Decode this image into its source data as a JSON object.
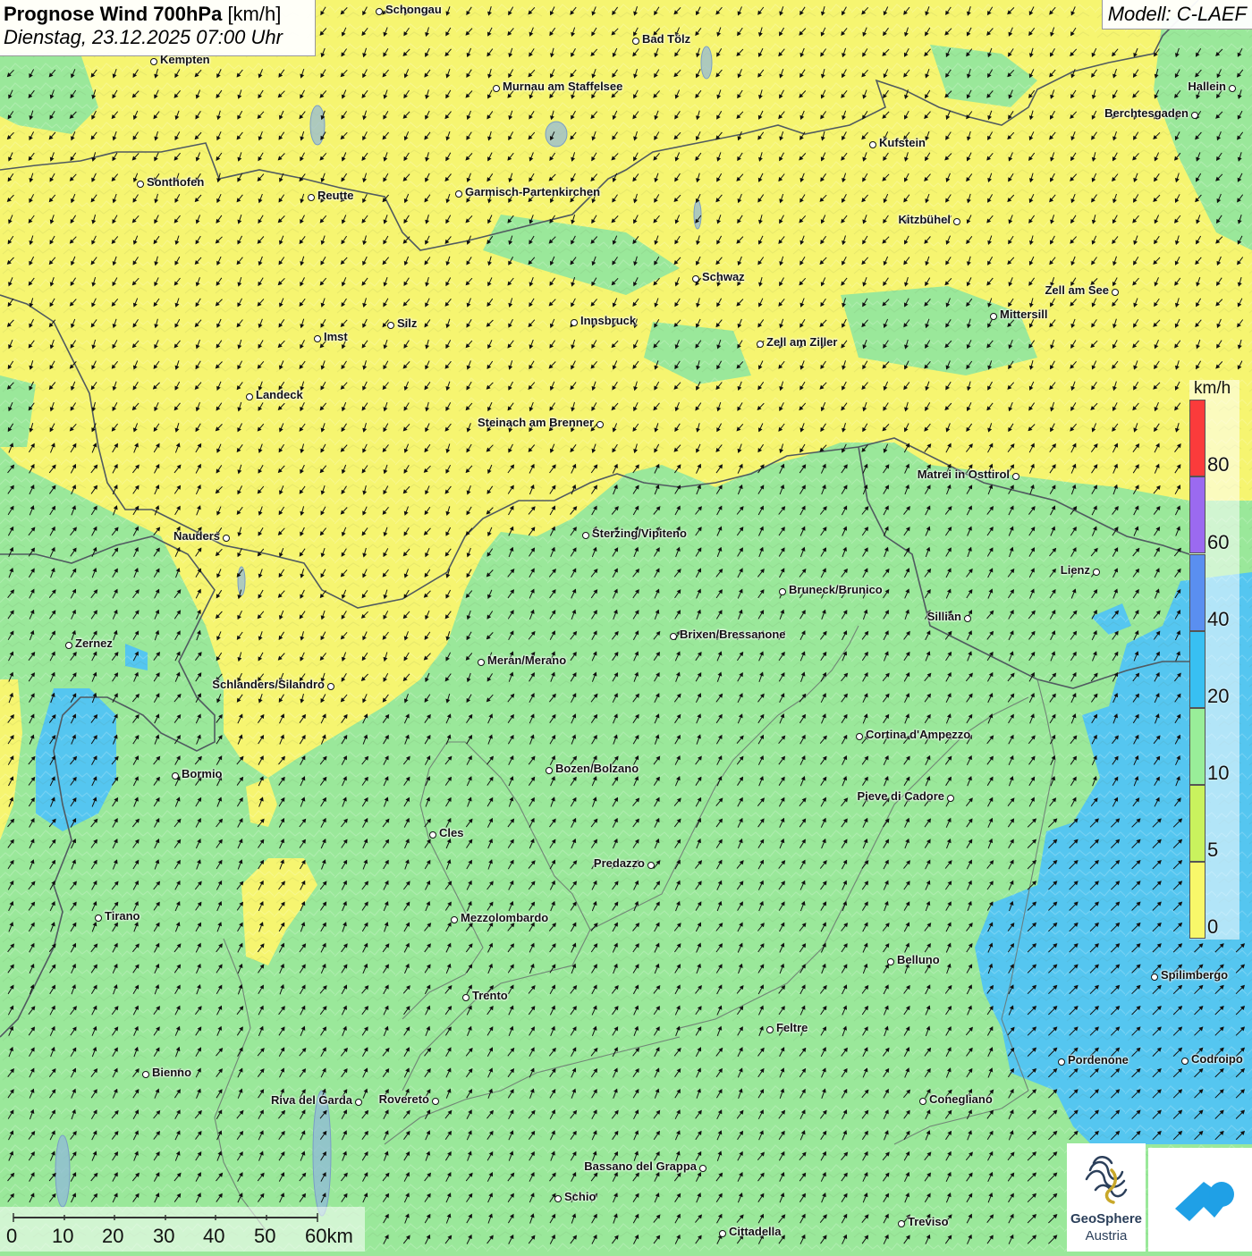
{
  "title": {
    "bold": "Prognose Wind 700hPa",
    "unit": "[km/h]",
    "datetime": "Dienstag, 23.12.2025 07:00 Uhr"
  },
  "model": "Modell: C-LAEF",
  "legend": {
    "unit": "km/h",
    "ticks": [
      "80",
      "60",
      "40",
      "20",
      "10",
      "5",
      "0"
    ],
    "colors": [
      "#fb3b3b",
      "#9b6af0",
      "#5a8ff0",
      "#38c0f2",
      "#99ee99",
      "#c9f25e",
      "#f8f86a"
    ]
  },
  "wind_field": {
    "north_zone": "0-5 km/h, wind from north-west",
    "south_zone": "5-10 km/h, wind from south-west",
    "south_east_zone": "10-20 km/h, wind from south-west"
  },
  "cities": [
    {
      "name": "Schongau"
    },
    {
      "name": "Bad Tölz"
    },
    {
      "name": "Kempten"
    },
    {
      "name": "Murnau am Staffelsee"
    },
    {
      "name": "Hallein"
    },
    {
      "name": "Berchtesgaden"
    },
    {
      "name": "Kufstein"
    },
    {
      "name": "Sonthofen"
    },
    {
      "name": "Reutte"
    },
    {
      "name": "Garmisch-Partenkirchen"
    },
    {
      "name": "Kitzbühel"
    },
    {
      "name": "Schwaz"
    },
    {
      "name": "Zell am See"
    },
    {
      "name": "Mittersill"
    },
    {
      "name": "Innsbruck"
    },
    {
      "name": "Silz"
    },
    {
      "name": "Imst"
    },
    {
      "name": "Zell am Ziller"
    },
    {
      "name": "Landeck"
    },
    {
      "name": "Steinach am Brenner"
    },
    {
      "name": "Matrei in Osttirol"
    },
    {
      "name": "Nauders"
    },
    {
      "name": "Sterzing/Vipiteno"
    },
    {
      "name": "Lienz"
    },
    {
      "name": "Bruneck/Brunico"
    },
    {
      "name": "Sillian"
    },
    {
      "name": "Brixen/Bressanone"
    },
    {
      "name": "Zernez"
    },
    {
      "name": "Meran/Merano"
    },
    {
      "name": "Schlanders/Silandro"
    },
    {
      "name": "Cortina d'Ampezzo"
    },
    {
      "name": "Bozen/Bolzano"
    },
    {
      "name": "Bormio"
    },
    {
      "name": "Pieve di Cadore"
    },
    {
      "name": "Cles"
    },
    {
      "name": "Predazzo"
    },
    {
      "name": "Tirano"
    },
    {
      "name": "Mezzolombardo"
    },
    {
      "name": "Belluno"
    },
    {
      "name": "Spilimbergo"
    },
    {
      "name": "Trento"
    },
    {
      "name": "Feltre"
    },
    {
      "name": "Pordenone"
    },
    {
      "name": "Codroipo"
    },
    {
      "name": "Bienno"
    },
    {
      "name": "Riva del Garda"
    },
    {
      "name": "Rovereto"
    },
    {
      "name": "Conegliano"
    },
    {
      "name": "Bassano del Grappa"
    },
    {
      "name": "Schio"
    },
    {
      "name": "Treviso"
    },
    {
      "name": "Cittadella"
    }
  ],
  "scale": {
    "labels": [
      "0",
      "10",
      "20",
      "30",
      "40",
      "50",
      "60km"
    ]
  },
  "logos": {
    "geosphere_line1": "GeoSphere",
    "geosphere_line2": "Austria"
  },
  "colors": {
    "calm": "#f8f86a",
    "light": "#99ee99",
    "moderate": "#38c0f2",
    "border": "#555555"
  }
}
